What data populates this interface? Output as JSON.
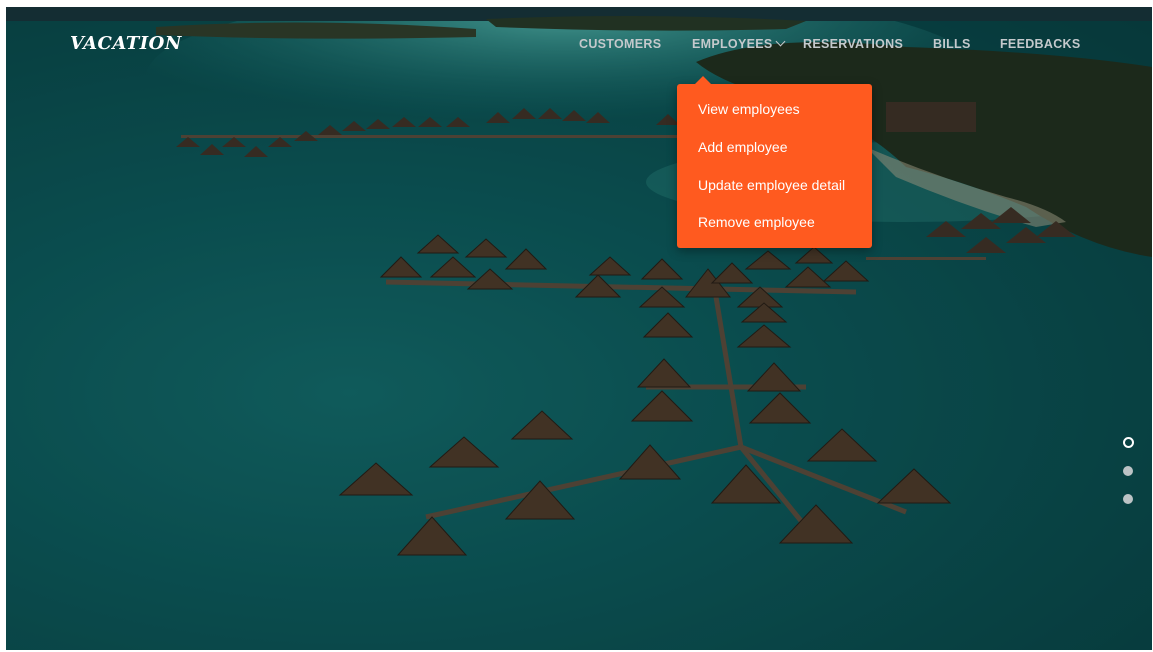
{
  "brand": {
    "logo_text": "VACATION"
  },
  "nav": {
    "items": [
      {
        "label": "CUSTOMERS"
      },
      {
        "label": "EMPLOYEES"
      },
      {
        "label": "RESERVATIONS"
      },
      {
        "label": "BILLS"
      },
      {
        "label": "FEEDBACKS"
      }
    ],
    "active": "EMPLOYEES"
  },
  "dropdown": {
    "items": [
      {
        "label": "View employees"
      },
      {
        "label": "Add employee"
      },
      {
        "label": "Update employee detail"
      },
      {
        "label": "Remove employee"
      }
    ],
    "color": "#ff5a1f"
  },
  "hero": {
    "slides_total": 3,
    "active_slide": 1,
    "water_color": "#0f6b6d"
  }
}
